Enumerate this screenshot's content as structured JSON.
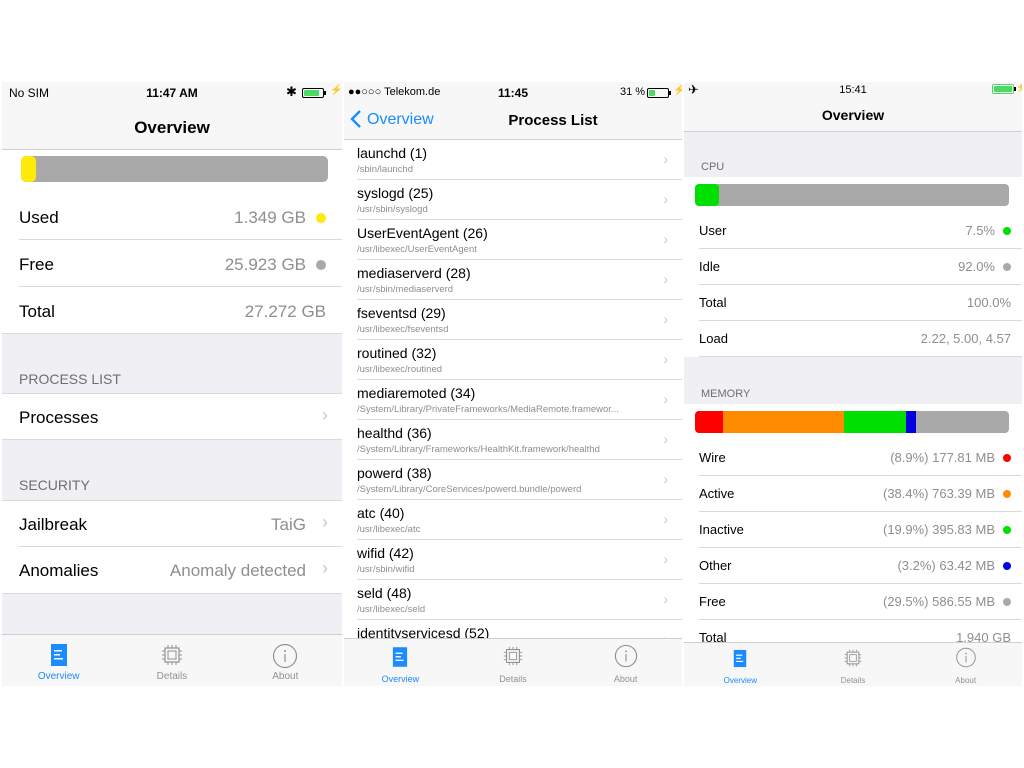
{
  "colors": {
    "accent": "#1a8cff",
    "yellow": "#ffeb0a",
    "green": "#00e000",
    "red": "#ff0000",
    "orange": "#ff8c00",
    "blue": "#0000e0",
    "gray": "#a9a9a9",
    "battery": "#4cd964"
  },
  "screen1": {
    "status": {
      "carrier": "No SIM",
      "time": "11:47 AM",
      "bluetooth_icon": "bluetooth-icon",
      "battery_level": 0.85
    },
    "title": "Overview",
    "storage_bar": {
      "used_fraction": 0.05
    },
    "rows": [
      {
        "label": "Used",
        "value": "1.349 GB",
        "dot": "#ffeb0a"
      },
      {
        "label": "Free",
        "value": "25.923 GB",
        "dot": "#a9a9a9"
      },
      {
        "label": "Total",
        "value": "27.272 GB"
      }
    ],
    "process_section": {
      "header": "PROCESS LIST",
      "row_label": "Processes"
    },
    "security_section": {
      "header": "SECURITY",
      "jailbreak_label": "Jailbreak",
      "jailbreak_value": "TaiG",
      "anomalies_label": "Anomalies",
      "anomalies_value": "Anomaly detected"
    },
    "tabs": [
      "Overview",
      "Details",
      "About"
    ]
  },
  "screen2": {
    "status": {
      "carrier": "●●○○○ Telekom.de",
      "time": "11:45",
      "battery": "31 %",
      "battery_level": 0.31
    },
    "back_label": "Overview",
    "title": "Process List",
    "processes": [
      {
        "name": "launchd (1)",
        "path": "/sbin/launchd"
      },
      {
        "name": "syslogd (25)",
        "path": "/usr/sbin/syslogd"
      },
      {
        "name": "UserEventAgent (26)",
        "path": "/usr/libexec/UserEventAgent"
      },
      {
        "name": "mediaserverd (28)",
        "path": "/usr/sbin/mediaserverd"
      },
      {
        "name": "fseventsd (29)",
        "path": "/usr/libexec/fseventsd"
      },
      {
        "name": "routined (32)",
        "path": "/usr/libexec/routined"
      },
      {
        "name": "mediaremoted (34)",
        "path": "/System/Library/PrivateFrameworks/MediaRemote.framewor..."
      },
      {
        "name": "healthd (36)",
        "path": "/System/Library/Frameworks/HealthKit.framework/healthd"
      },
      {
        "name": "powerd (38)",
        "path": "/System/Library/CoreServices/powerd.bundle/powerd"
      },
      {
        "name": "atc (40)",
        "path": "/usr/libexec/atc"
      },
      {
        "name": "wifid (42)",
        "path": "/usr/sbin/wifid"
      },
      {
        "name": "seld (48)",
        "path": "/usr/libexec/seld"
      },
      {
        "name": "identityservicesd (52)",
        "path": ""
      }
    ],
    "tabs": [
      "Overview",
      "Details",
      "About"
    ]
  },
  "screen3": {
    "status": {
      "airplane_icon": "airplane-icon",
      "time": "15:41",
      "battery_level": 1.0
    },
    "title": "Overview",
    "cpu": {
      "header": "CPU",
      "bar_fraction": 0.075,
      "rows": [
        {
          "label": "User",
          "value": "7.5%",
          "dot": "#00e000"
        },
        {
          "label": "Idle",
          "value": "92.0%",
          "dot": "#a9a9a9"
        },
        {
          "label": "Total",
          "value": "100.0%"
        },
        {
          "label": "Load",
          "value": "2.22, 5.00, 4.57"
        }
      ]
    },
    "memory": {
      "header": "MEMORY",
      "bar_segments": [
        {
          "fraction": 0.089,
          "color": "#ff0000"
        },
        {
          "fraction": 0.384,
          "color": "#ff8c00"
        },
        {
          "fraction": 0.199,
          "color": "#00e000"
        },
        {
          "fraction": 0.032,
          "color": "#0000e0"
        },
        {
          "fraction": 0.295,
          "color": "#a9a9a9"
        }
      ],
      "rows": [
        {
          "label": "Wire",
          "value": "(8.9%) 177.81 MB",
          "dot": "#ff0000"
        },
        {
          "label": "Active",
          "value": "(38.4%) 763.39 MB",
          "dot": "#ff8c00"
        },
        {
          "label": "Inactive",
          "value": "(19.9%) 395.83 MB",
          "dot": "#00e000"
        },
        {
          "label": "Other",
          "value": "(3.2%) 63.42 MB",
          "dot": "#0000e0"
        },
        {
          "label": "Free",
          "value": "(29.5%) 586.55 MB",
          "dot": "#a9a9a9"
        },
        {
          "label": "Total",
          "value": "1.940 GB"
        }
      ]
    },
    "tabs": [
      "Overview",
      "Details",
      "About"
    ]
  }
}
